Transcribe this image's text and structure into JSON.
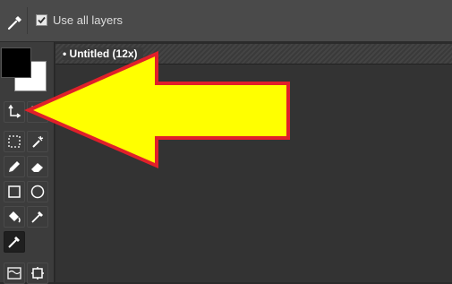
{
  "toolbar": {
    "tool_icon": "eyedropper-icon",
    "use_all_layers_label": "Use all layers",
    "use_all_layers_checked": true
  },
  "colors": {
    "foreground": "#000000",
    "background": "#ffffff",
    "annotation_fill": "#ffff00",
    "annotation_stroke": "#e0202a"
  },
  "canvas": {
    "title": "• Untitled   (12x)"
  },
  "tools": [
    {
      "icon": "swap-colors-icon"
    },
    {
      "icon": "reset-colors-icon"
    },
    {
      "icon": "marquee-select-icon"
    },
    {
      "icon": "magic-wand-icon"
    },
    {
      "icon": "pencil-icon"
    },
    {
      "icon": "eraser-icon"
    },
    {
      "icon": "rectangle-icon"
    },
    {
      "icon": "ellipse-icon"
    },
    {
      "icon": "fill-bucket-icon"
    },
    {
      "icon": "eyedropper-brush-icon"
    },
    {
      "icon": "color-picker-icon",
      "active": true
    },
    {
      "icon": "gradient-icon"
    },
    {
      "icon": "crop-icon"
    }
  ]
}
